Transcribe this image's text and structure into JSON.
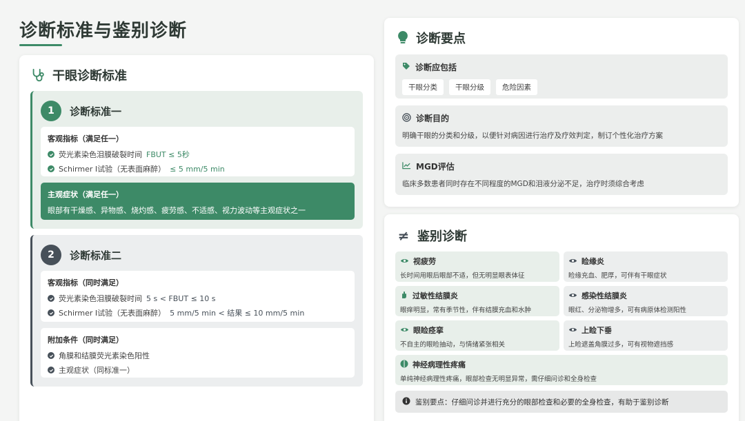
{
  "page": {
    "title": "诊断标准与鉴别诊断"
  },
  "colors": {
    "accent": "#3d8a67",
    "dark": "#475059"
  },
  "dry_eye": {
    "title": "干眼诊断标准",
    "criteria1": {
      "number": "1",
      "title": "诊断标准一",
      "objective_title": "客观指标（满足任一）",
      "objective_items": [
        {
          "text": "荧光素染色泪膜破裂时间 ",
          "value": "FBUT ≤ 5秒"
        },
        {
          "text": "Schirmer Ⅰ试验（无表面麻醉） ",
          "value": "≤ 5 mm/5 min"
        }
      ],
      "subjective_title": "主观症状（满足任一）",
      "subjective_text": "眼部有干燥感、异物感、烧灼感、疲劳感、不适感、视力波动等主观症状之一"
    },
    "criteria2": {
      "number": "2",
      "title": "诊断标准二",
      "objective_title": "客观指标（同时满足）",
      "objective_items": [
        {
          "text": "荧光素染色泪膜破裂时间 ",
          "value": "5 s < FBUT ≤ 10 s"
        },
        {
          "text": "Schirmer Ⅰ试验（无表面麻醉） ",
          "value": "5 mm/5 min < 结果 ≤ 10 mm/5 min"
        }
      ],
      "additional_title": "附加条件（同时满足）",
      "additional_items": [
        "角膜和结膜荧光素染色阳性",
        "主观症状（同标准一）"
      ]
    }
  },
  "key_points": {
    "title": "诊断要点",
    "include": {
      "title": "诊断应包括",
      "tags": [
        "干眼分类",
        "干眼分级",
        "危险因素"
      ]
    },
    "purpose": {
      "title": "诊断目的",
      "text": "明确干眼的分类和分级，以便针对病因进行治疗及疗效判定，制订个性化治疗方案"
    },
    "mgd": {
      "title": "MGD评估",
      "text": "临床多数患者同时存在不同程度的MGD和泪液分泌不足，治疗时须综合考虑"
    }
  },
  "differential": {
    "title": "鉴别诊断",
    "items": [
      {
        "title": "视疲劳",
        "text": "长时间用眼后眼部不适，但无明显眼表体征"
      },
      {
        "title": "睑缘炎",
        "text": "睑缘充血、肥厚，可伴有干眼症状"
      },
      {
        "title": "过敏性结膜炎",
        "text": "眼痒明显，常有季节性，伴有结膜充血和水肿"
      },
      {
        "title": "感染性结膜炎",
        "text": "眼红、分泌物增多，可有病原体检测阳性"
      },
      {
        "title": "眼睑痉挛",
        "text": "不自主的眼睑抽动，与情绪紧张相关"
      },
      {
        "title": "上睑下垂",
        "text": "上睑遮盖角膜过多，可有视物遮挡感"
      },
      {
        "title": "神经病理性疼痛",
        "text": "单纯神经病理性疼痛，眼部检查无明显异常，需仔细问诊和全身检查"
      }
    ],
    "summary": "鉴别要点：仔细问诊并进行充分的眼部检查和必要的全身检查，有助于鉴别诊断"
  }
}
